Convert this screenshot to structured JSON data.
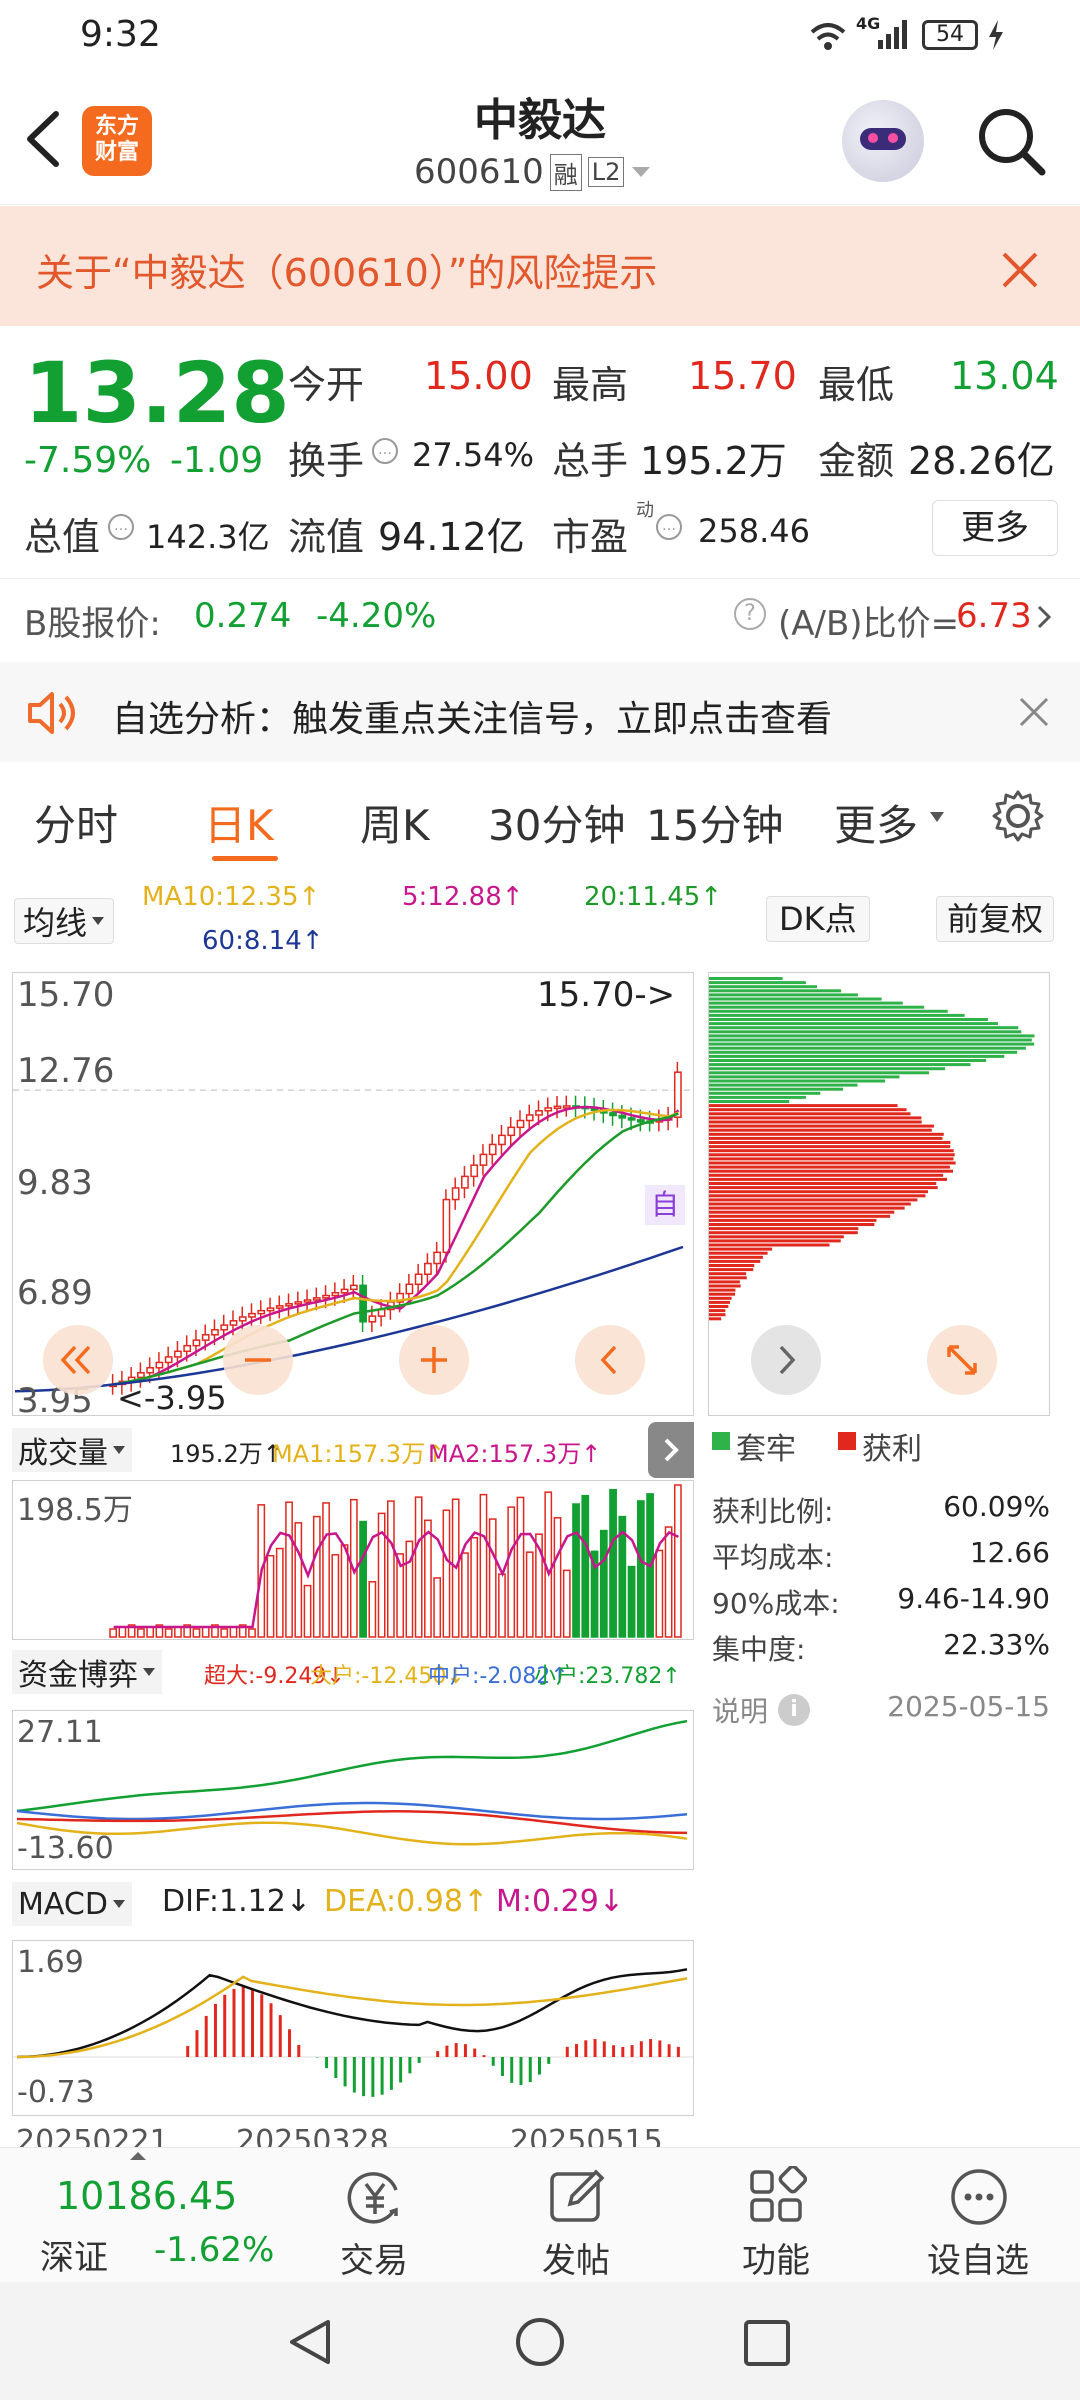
{
  "status": {
    "time": "9:32",
    "battery": "54",
    "network": "4G"
  },
  "header": {
    "logo_line1": "东方",
    "logo_line2": "财富",
    "stock_name": "中毅达",
    "stock_code": "600610",
    "badge_rong": "融",
    "badge_level": "L2"
  },
  "risk_banner": {
    "text": "关于“中毅达（600610）”的风险提示"
  },
  "quote": {
    "price": "13.28",
    "change_pct": "-7.59%",
    "change": "-1.09",
    "open_label": "今开",
    "open": "15.00",
    "high_label": "最高",
    "high": "15.70",
    "low_label": "最低",
    "low": "13.04",
    "turnover_label": "换手",
    "turnover": "27.54%",
    "volume_label": "总手",
    "volume": "195.2万",
    "amount_label": "金额",
    "amount": "28.26亿",
    "mktcap_label": "总值",
    "mktcap": "142.3亿",
    "float_label": "流值",
    "float": "94.12亿",
    "pe_label": "市盈",
    "pe_sup": "动",
    "pe": "258.46",
    "more_button": "更多",
    "bshare_label": "B股报价:",
    "bshare_price": "0.274",
    "bshare_pct": "-4.20%",
    "ab_label": "(A/B)比价=",
    "ab_value": "6.73"
  },
  "notice": {
    "text": "自选分析：触发重点关注信号，立即点击查看"
  },
  "tabs": [
    "分时",
    "日K",
    "周K",
    "30分钟",
    "15分钟",
    "更多"
  ],
  "active_tab": 1,
  "kline": {
    "ma_selector": "均线",
    "ma10": "MA10:12.35↑",
    "ma5": "5:12.88↑",
    "ma20": "20:11.45↑",
    "ma60": "60:8.14↑",
    "dk_button": "DK点",
    "adjust_button": "前复权",
    "price_ticks": [
      "15.70",
      "12.76",
      "9.83",
      "6.89",
      "3.95"
    ],
    "max_label": "15.70->",
    "min_label": "<-3.95",
    "auto_label": "自",
    "colors": {
      "up": "#e0281e",
      "down": "#12a033",
      "ma5": "#c8178d",
      "ma10": "#e3b21b",
      "ma20": "#1e9a2b",
      "ma60": "#1d3796"
    }
  },
  "chip": {
    "legend_trapped": "套牢",
    "legend_profit": "获利",
    "rows": [
      {
        "label": "获利比例:",
        "value": "60.09%"
      },
      {
        "label": "平均成本:",
        "value": "12.66"
      },
      {
        "label": "90%成本:",
        "value": "9.46-14.90"
      },
      {
        "label": "集中度:",
        "value": "22.33%"
      }
    ],
    "note_label": "说明",
    "date": "2025-05-15"
  },
  "volume": {
    "selector": "成交量",
    "value": "195.2万↑",
    "ma1": "MA1:157.3万↑",
    "ma2": "MA2:157.3万↑",
    "top_tick": "198.5万"
  },
  "fund": {
    "selector": "资金博弈",
    "super": "超大:-9.249↓",
    "large": "大户:-12.450↓",
    "mid": "中户:-2.082↑",
    "small": "小户:23.782↑",
    "top_tick": "27.11",
    "bottom_tick": "-13.60"
  },
  "macd": {
    "selector": "MACD",
    "dif": "DIF:1.12↓",
    "dea": "DEA:0.98↑",
    "m": "M:0.29↓",
    "top_tick": "1.69",
    "bottom_tick": "-0.73",
    "dates": [
      "20250221",
      "20250328",
      "20250515"
    ]
  },
  "bottom_nav": {
    "index_value": "10186.45",
    "index_name": "深证",
    "index_pct": "-1.62%",
    "items": [
      "交易",
      "发帖",
      "功能",
      "设自选"
    ]
  }
}
